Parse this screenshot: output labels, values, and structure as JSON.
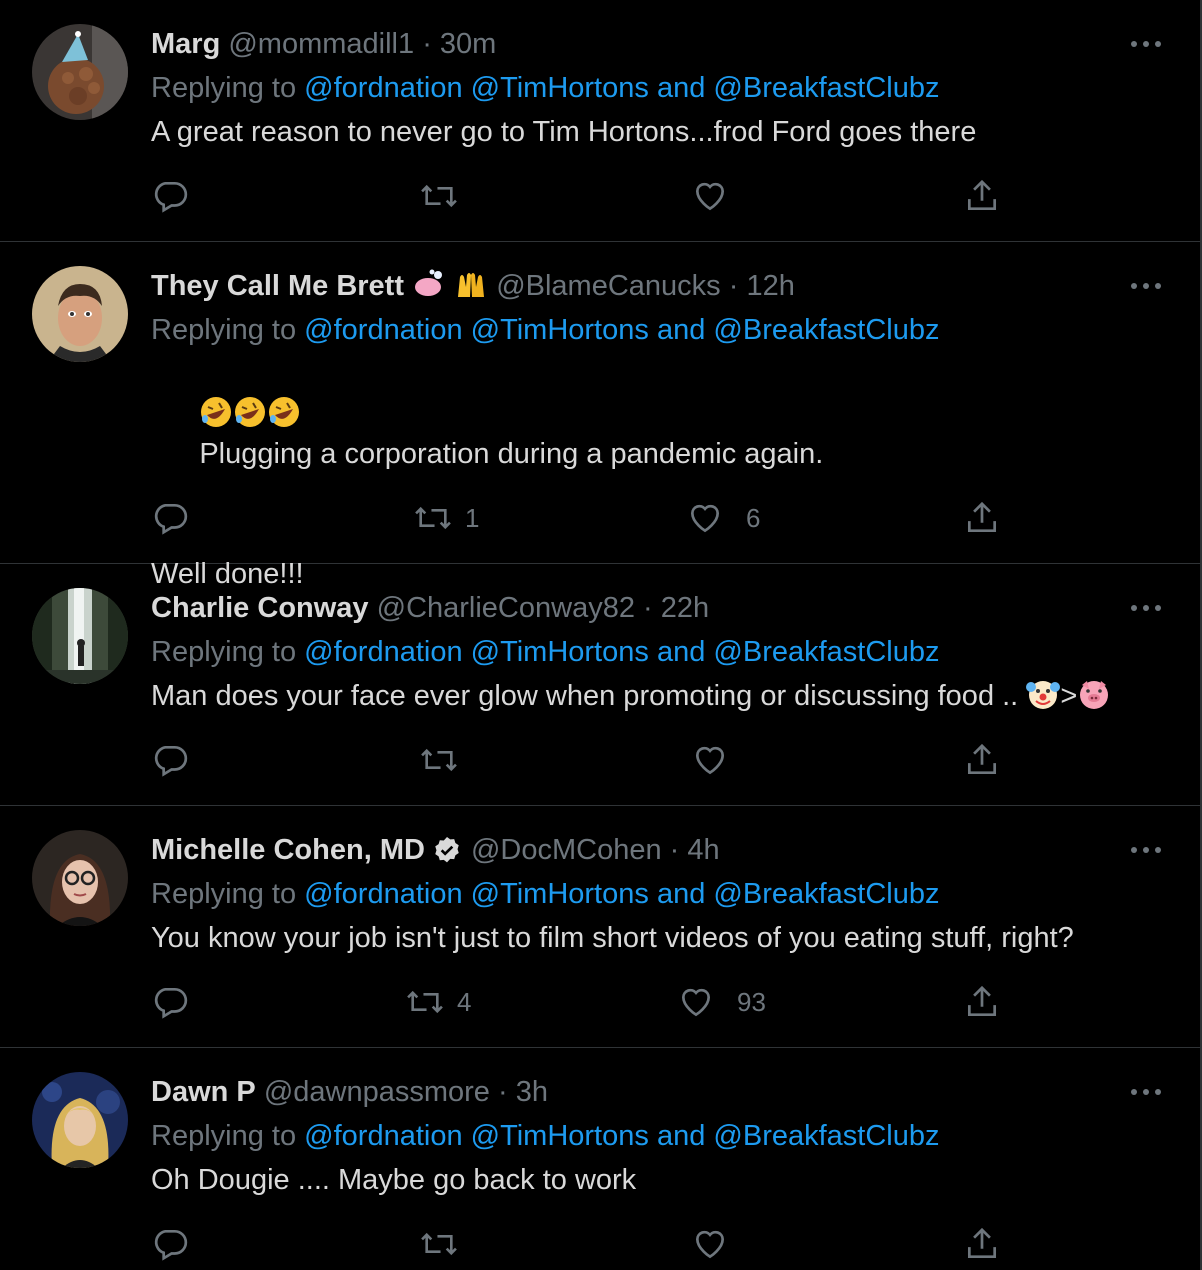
{
  "reply_prefix": "Replying to",
  "mentions": [
    "@fordnation",
    "@TimHortons",
    "and",
    "@BreakfastClubz"
  ],
  "separator": "·",
  "tweets": [
    {
      "name": "Marg",
      "handle": "@mommadill1",
      "time": "30m",
      "text": "A great reason to never go to Tim Hortons...frod Ford goes there",
      "retweets": "",
      "likes": "",
      "avatar_icon": "dog-with-party-hat-avatar"
    },
    {
      "name": "They Call Me Brett",
      "handle": "@BlameCanucks",
      "time": "12h",
      "name_emojis": [
        "soap-emoji",
        "raised-hands-emoji"
      ],
      "text_emojis": [
        "rolling-on-floor-laughing-emoji",
        "rolling-on-floor-laughing-emoji",
        "rolling-on-floor-laughing-emoji"
      ],
      "text": "Plugging a corporation during a pandemic again.",
      "text2": "Well done!!!",
      "retweets": "1",
      "likes": "6",
      "avatar_icon": "man-portrait-avatar"
    },
    {
      "name": "Charlie Conway",
      "handle": "@CharlieConway82",
      "time": "22h",
      "text": "Man does your face ever glow when promoting or discussing food ..",
      "trailing_emojis": [
        "clown-face-emoji",
        "pig-face-emoji"
      ],
      "trailing_symbol": ">",
      "retweets": "",
      "likes": "",
      "avatar_icon": "forest-waterfall-avatar"
    },
    {
      "name": "Michelle Cohen, MD",
      "handle": "@DocMCohen",
      "time": "4h",
      "verified": true,
      "text": "You know your job isn't just to film short videos of you eating stuff, right?",
      "retweets": "4",
      "likes": "93",
      "avatar_icon": "woman-with-glasses-avatar"
    },
    {
      "name": "Dawn P",
      "handle": "@dawnpassmore",
      "time": "3h",
      "text": "Oh Dougie .... Maybe go back to work",
      "retweets": "",
      "likes": "",
      "avatar_icon": "blonde-woman-avatar"
    }
  ],
  "colors": {
    "background": "#000000",
    "text": "#d9d9d9",
    "muted": "#6e767d",
    "link": "#1d9bf0",
    "divider": "#2f3336"
  }
}
